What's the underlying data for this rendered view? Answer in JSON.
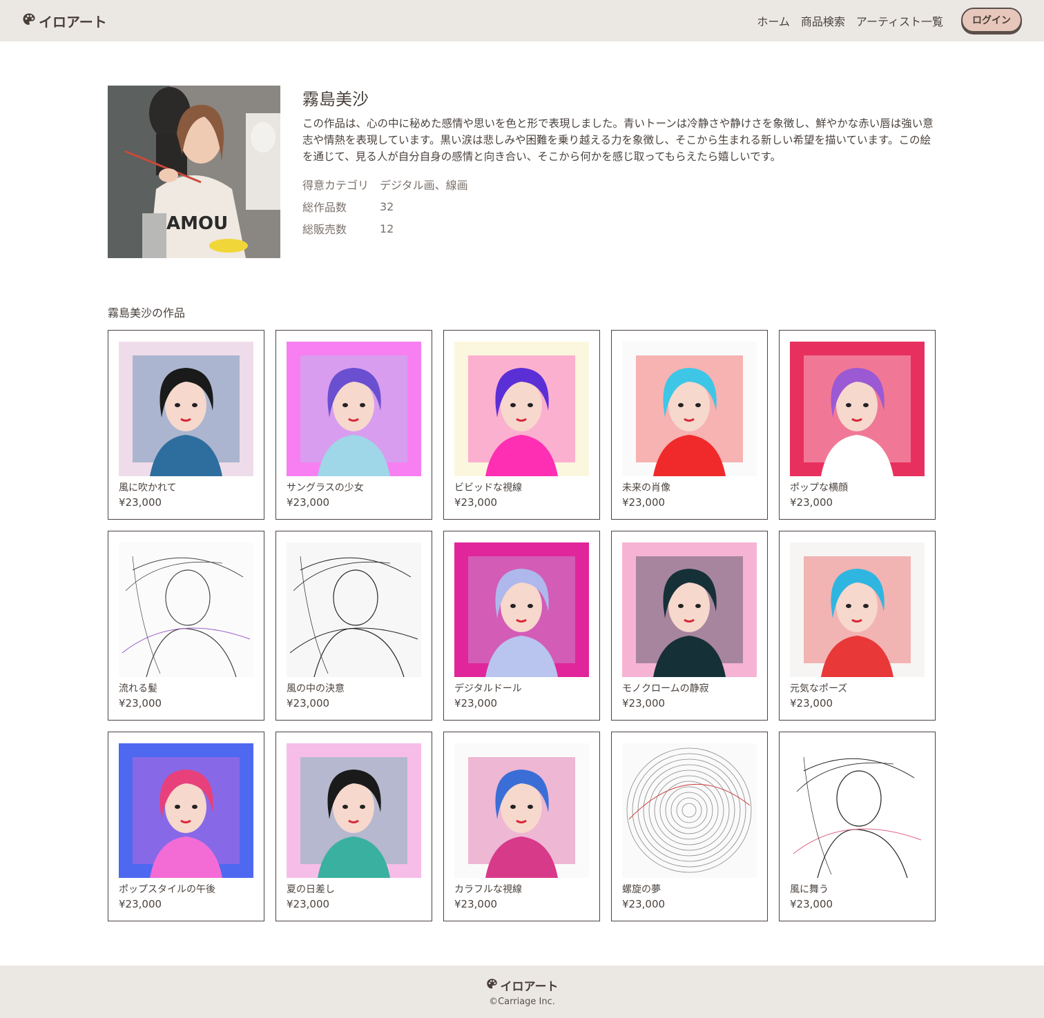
{
  "header": {
    "logo_text": "イロアート",
    "logo_icon": "palette-icon",
    "nav": [
      {
        "label": "ホーム"
      },
      {
        "label": "商品検索"
      },
      {
        "label": "アーティスト一覧"
      }
    ],
    "login_label": "ログイン"
  },
  "artist": {
    "name": "霧島美沙",
    "bio": "この作品は、心の中に秘めた感情や思いを色と形で表現しました。青いトーンは冷静さや静けさを象徴し、鮮やかな赤い唇は強い意志や情熱を表現しています。黒い涙は悲しみや困難を乗り越える力を象徴し、そこから生まれる新しい希望を描いています。この絵を通じて、見る人が自分自身の感情と向き合い、そこから何かを感じ取ってもらえたら嬉しいです。",
    "stats": [
      {
        "label": "得意カテゴリ",
        "value": "デジタル画、線画"
      },
      {
        "label": "総作品数",
        "value": "32"
      },
      {
        "label": "総販売数",
        "value": "12"
      }
    ]
  },
  "works_section": {
    "title": "霧島美沙の作品"
  },
  "works": [
    {
      "title": "風に吹かれて",
      "price": "¥23,000",
      "bg": "#efdcea",
      "accent": "#2e6e9e",
      "hair": "#1a1a1a",
      "style": "color"
    },
    {
      "title": "サングラスの少女",
      "price": "¥23,000",
      "bg": "#f77ff2",
      "accent": "#9fd6e8",
      "hair": "#6a4fd0",
      "style": "color"
    },
    {
      "title": "ビビッドな視線",
      "price": "¥23,000",
      "bg": "#fbf6de",
      "accent": "#ff2fb4",
      "hair": "#5b2fd6",
      "style": "color"
    },
    {
      "title": "未来の肖像",
      "price": "¥23,000",
      "bg": "#fafafa",
      "accent": "#f02a2a",
      "hair": "#3ec6e6",
      "style": "color"
    },
    {
      "title": "ポップな横顔",
      "price": "¥23,000",
      "bg": "#e8305e",
      "accent": "#ffffff",
      "hair": "#9b59d4",
      "style": "color"
    },
    {
      "title": "流れる髪",
      "price": "¥23,000",
      "bg": "#fbfbfb",
      "accent": "#9c5fc9",
      "hair": "#444444",
      "style": "sketch"
    },
    {
      "title": "風の中の決意",
      "price": "¥23,000",
      "bg": "#f7f7f7",
      "accent": "#222222",
      "hair": "#222222",
      "style": "sketch"
    },
    {
      "title": "デジタルドール",
      "price": "¥23,000",
      "bg": "#e0269a",
      "accent": "#b9c4ef",
      "hair": "#aeb8ec",
      "style": "color"
    },
    {
      "title": "モノクロームの静寂",
      "price": "¥23,000",
      "bg": "#f6b3d4",
      "accent": "#163038",
      "hair": "#163038",
      "style": "color"
    },
    {
      "title": "元気なポーズ",
      "price": "¥23,000",
      "bg": "#f7f5f4",
      "accent": "#e83838",
      "hair": "#2fb6e0",
      "style": "color"
    },
    {
      "title": "ポップスタイルの午後",
      "price": "¥23,000",
      "bg": "#4e68f0",
      "accent": "#f36cd6",
      "hair": "#e8407a",
      "style": "color"
    },
    {
      "title": "夏の日差し",
      "price": "¥23,000",
      "bg": "#f7bde9",
      "accent": "#3ab0a0",
      "hair": "#1a1a1a",
      "style": "color"
    },
    {
      "title": "カラフルな視線",
      "price": "¥23,000",
      "bg": "#fafafa",
      "accent": "#d83a8a",
      "hair": "#3a6ed6",
      "style": "color"
    },
    {
      "title": "螺旋の夢",
      "price": "¥23,000",
      "bg": "#fafafa",
      "accent": "#d04040",
      "hair": "#555555",
      "style": "spiral"
    },
    {
      "title": "風に舞う",
      "price": "¥23,000",
      "bg": "#ffffff",
      "accent": "#e06080",
      "hair": "#222222",
      "style": "sketch"
    }
  ],
  "footer": {
    "logo_text": "イロアート",
    "copyright": "©Carriage Inc."
  }
}
